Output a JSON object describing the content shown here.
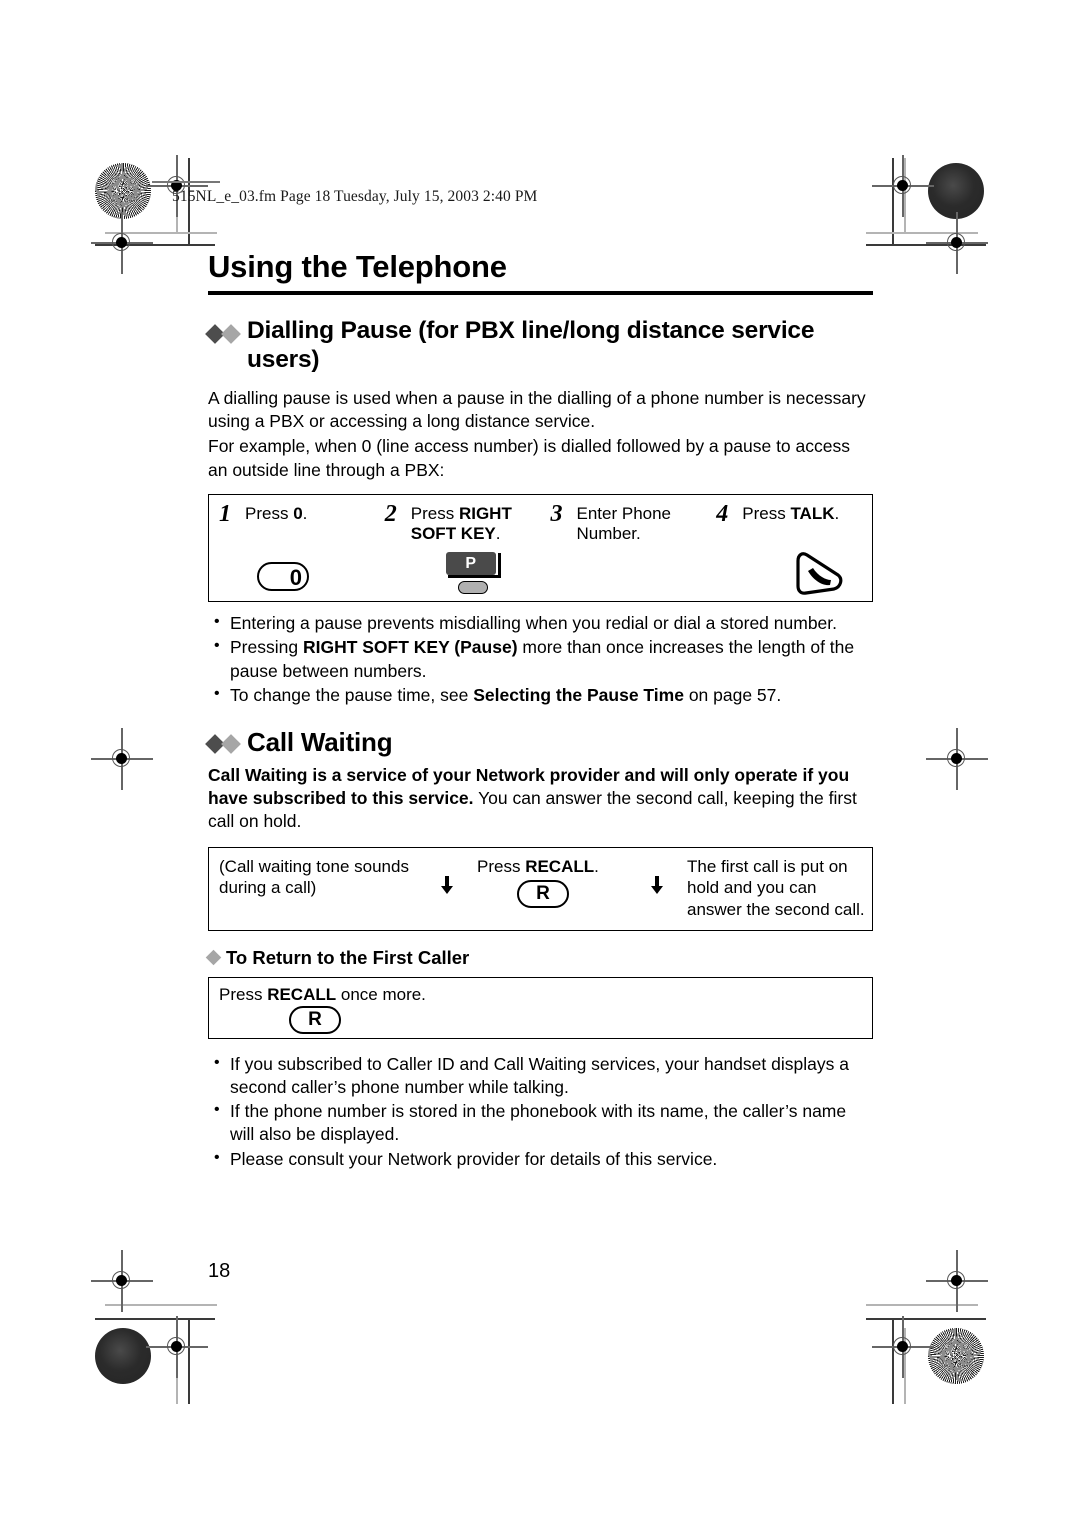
{
  "file_header": "515NL_e_03.fm  Page 18  Tuesday, July 15, 2003  2:40 PM",
  "page_title": "Using the Telephone",
  "page_number": "18",
  "colors": {
    "diamond_dark": "#4d4d4d",
    "diamond_light": "#a6a6a6",
    "softkey_plate": "#4a4a4a",
    "softkey_pill": "#b0b0b0",
    "rule": "#000000"
  },
  "sections": [
    {
      "heading": "Dialling Pause (for PBX line/long distance service users)",
      "paragraphs": [
        "A dialling pause is used when a pause in the dialling of a phone number is necessary using a PBX or accessing a long distance service.",
        "For example, when 0 (line access number) is dialled followed by a pause to access an outside line through a PBX:"
      ],
      "steps": [
        {
          "num": "1",
          "text_pre": "Press ",
          "text_bold": "0",
          "text_post": ".",
          "icon": "key-zero-icon"
        },
        {
          "num": "2",
          "text_pre": "Press ",
          "text_bold": "RIGHT SOFT KEY",
          "text_post": ".",
          "icon": "right-soft-key-pause-icon",
          "icon_label": "P"
        },
        {
          "num": "3",
          "text_pre": "Enter Phone Number.",
          "text_bold": "",
          "text_post": "",
          "icon": "none"
        },
        {
          "num": "4",
          "text_pre": "Press ",
          "text_bold": "TALK",
          "text_post": ".",
          "icon": "talk-handset-icon"
        }
      ],
      "bullets": [
        {
          "pre": "Entering a pause prevents misdialling when you redial or dial a stored number.",
          "bold": "",
          "post": ""
        },
        {
          "pre": "Pressing ",
          "bold": "RIGHT SOFT KEY (Pause)",
          "post": " more than once increases the length of the pause between numbers."
        },
        {
          "pre": "To change the pause time, see ",
          "bold": "Selecting the Pause Time",
          "post": " on page 57."
        }
      ]
    },
    {
      "heading": "Call Waiting",
      "lead_bold": "Call Waiting is a service of your Network provider and will only operate if you have subscribed to this service.",
      "lead_rest": " You can answer the second call, keeping the first call on hold.",
      "flow": {
        "cell1": "(Call waiting tone sounds during a call)",
        "arrow1": "down-arrow-icon",
        "cell2_pre": "Press ",
        "cell2_bold": "RECALL",
        "cell2_post": ".",
        "cell2_key": "R",
        "arrow2": "down-arrow-icon",
        "cell3": "The first call is put on hold and you can answer the second call."
      },
      "sub_heading": "To Return to the First Caller",
      "return_box": {
        "pre": "Press ",
        "bold": "RECALL",
        "post": " once more.",
        "key": "R"
      },
      "bullets": [
        {
          "pre": "If you subscribed to Caller ID and Call Waiting services, your handset displays a second caller’s phone number while talking.",
          "bold": "",
          "post": ""
        },
        {
          "pre": "If the phone number is stored in the phonebook with its name, the caller’s name will also be displayed.",
          "bold": "",
          "post": ""
        },
        {
          "pre": "Please consult your Network provider for details of this service.",
          "bold": "",
          "post": ""
        }
      ]
    }
  ]
}
